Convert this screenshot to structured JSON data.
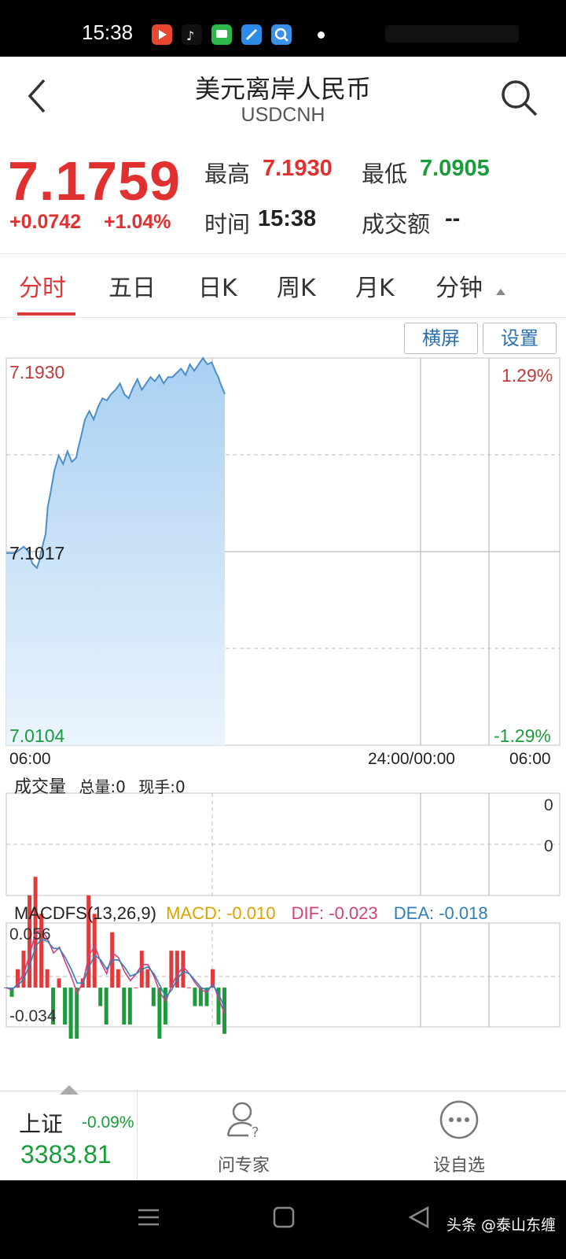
{
  "status_bar": {
    "time": "15:38"
  },
  "header": {
    "title": "美元离岸人民币",
    "subtitle": "USDCNH"
  },
  "quote": {
    "price": "7.1759",
    "change": "+0.0742",
    "change_pct": "+1.04%",
    "high_label": "最高",
    "high": "7.1930",
    "low_label": "最低",
    "low": "7.0905",
    "time_label": "时间",
    "time": "15:38",
    "turnover_label": "成交额",
    "turnover": "--",
    "up_color": "#e03030",
    "down_color": "#1a9c3a"
  },
  "tabs": [
    {
      "label": "分时",
      "active": true
    },
    {
      "label": "五日"
    },
    {
      "label": "日K"
    },
    {
      "label": "周K"
    },
    {
      "label": "月K"
    },
    {
      "label": "分钟"
    }
  ],
  "chart_buttons": {
    "landscape": "横屏",
    "settings": "设置"
  },
  "chart_data": [
    {
      "type": "area",
      "y_labels": {
        "top": "7.1930",
        "mid": "7.1017",
        "bottom": "7.0104"
      },
      "pct_labels": {
        "top": "1.29%",
        "bottom": "-1.29%"
      },
      "x_labels": [
        "06:00",
        "24:00/00:00",
        "06:00"
      ],
      "ylim": [
        7.0104,
        7.193
      ],
      "x": [
        0,
        4,
        8,
        10,
        12,
        14,
        15,
        16,
        18,
        19,
        20,
        22,
        24,
        26,
        28,
        30,
        32,
        33,
        34,
        36,
        38,
        40,
        42,
        44,
        46,
        48,
        50,
        52,
        54,
        56,
        58,
        60,
        62,
        64,
        66,
        68,
        70,
        72,
        74,
        76,
        78,
        80,
        82,
        84,
        86,
        88,
        90,
        92,
        94,
        96,
        97,
        98,
        100
      ],
      "values": [
        7.101,
        7.101,
        7.104,
        7.102,
        7.096,
        7.094,
        7.097,
        7.102,
        7.11,
        7.123,
        7.128,
        7.14,
        7.147,
        7.143,
        7.149,
        7.144,
        7.146,
        7.151,
        7.155,
        7.164,
        7.168,
        7.164,
        7.17,
        7.174,
        7.173,
        7.176,
        7.178,
        7.181,
        7.176,
        7.174,
        7.179,
        7.183,
        7.178,
        7.181,
        7.184,
        7.182,
        7.185,
        7.181,
        7.184,
        7.184,
        7.186,
        7.188,
        7.185,
        7.19,
        7.187,
        7.19,
        7.193,
        7.19,
        7.191,
        7.186,
        7.184,
        7.181,
        7.176
      ],
      "fill_color": "#bcdcf6",
      "line_color": "#4c8fc8"
    },
    {
      "type": "bar",
      "title": "成交量",
      "total_label": "总量:0",
      "current_label": "现手:0",
      "y_labels": [
        "0",
        "0"
      ]
    },
    {
      "type": "line",
      "title": "MACDFS(13,26,9)",
      "macd_label": "MACD: -0.010",
      "dif_label": "DIF: -0.023",
      "dea_label": "DEA: -0.018",
      "y_labels": {
        "top": "0.056",
        "bottom": "-0.034"
      },
      "ylim": [
        -0.034,
        0.056
      ],
      "dif": [
        0.0,
        -0.002,
        0.004,
        0.012,
        0.03,
        0.048,
        0.05,
        0.042,
        0.03,
        0.035,
        0.022,
        0.01,
        -0.005,
        0.005,
        0.028,
        0.036,
        0.022,
        0.012,
        0.03,
        0.026,
        0.014,
        0.006,
        0.012,
        0.02,
        0.02,
        0.01,
        -0.004,
        -0.012,
        0.002,
        0.012,
        0.018,
        0.012,
        0.004,
        -0.002,
        -0.004,
        0.004,
        -0.01,
        -0.023
      ],
      "dea": [
        0.0,
        -0.001,
        0.002,
        0.008,
        0.02,
        0.036,
        0.042,
        0.04,
        0.034,
        0.034,
        0.026,
        0.016,
        0.004,
        0.004,
        0.018,
        0.028,
        0.024,
        0.016,
        0.024,
        0.024,
        0.018,
        0.01,
        0.012,
        0.016,
        0.018,
        0.012,
        0.002,
        -0.008,
        -0.002,
        0.008,
        0.014,
        0.012,
        0.006,
        0.0,
        -0.002,
        0.002,
        -0.006,
        -0.018
      ],
      "dif_color": "#d04080",
      "dea_color": "#2f7fb8",
      "bar_pos_color": "#e23a3a",
      "bar_neg_color": "#1a9c3a",
      "macd_label_color": "#e0a000"
    }
  ],
  "bottom_bar": {
    "index_name": "上证",
    "index_change": "-0.09%",
    "index_value": "3383.81",
    "ask_expert": "问专家",
    "set_watchlist": "设自选"
  },
  "watermark": "头条 @泰山东缠"
}
